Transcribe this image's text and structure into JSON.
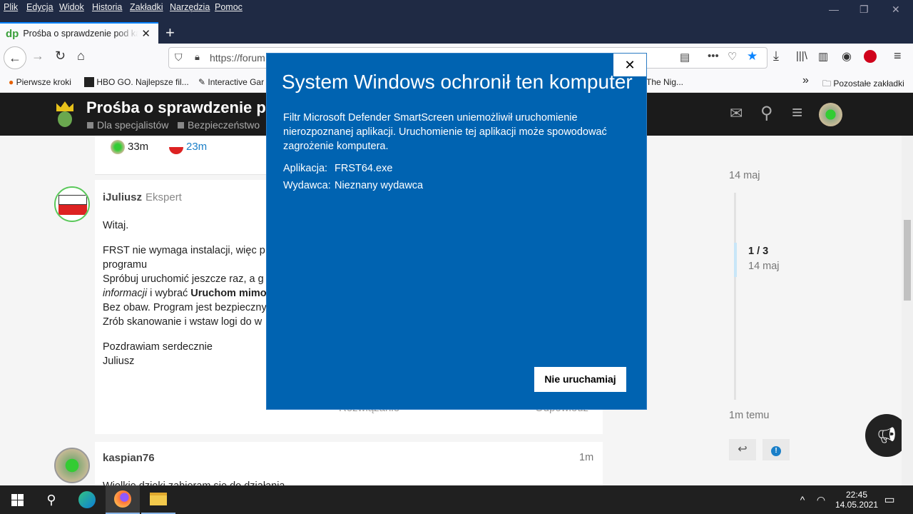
{
  "menubar": {
    "items": [
      "Plik",
      "Edycja",
      "Widok",
      "Historia",
      "Zakładki",
      "Narzędzia",
      "Pomoc"
    ]
  },
  "tab": {
    "favicon": "dp",
    "title": "Prośba o sprawdzenie pod kątem"
  },
  "urlbar": {
    "url": "https://forum"
  },
  "bookmarks": {
    "items": [
      "Pierwsze kroki",
      "HBO GO. Najlepsze fil...",
      "Interactive Gar",
      "The Nig..."
    ],
    "other": "Pozostałe zakładki"
  },
  "forum": {
    "title": "Prośba o sprawdzenie po",
    "categories": [
      "Dla specjalistów",
      "Bezpieczeństwo"
    ]
  },
  "summary": {
    "created": "33m",
    "last_reply": "23m"
  },
  "post1": {
    "user": "iJuliusz",
    "role": "Ekspert",
    "greeting": "Witaj.",
    "line1": "FRST nie wymaga instalacji, więc p",
    "line2": "programu",
    "line3": "Spróbuj uruchomić jeszcze raz, a g",
    "line4a": "informacji",
    "line4b": " i wybrać ",
    "line4c": "Uruchom mimo",
    "line5": "Bez obaw. Program jest bezpieczny",
    "line6": "Zrób skanowanie i wstaw logi do w",
    "regards": "Pozdrawiam serdecznie",
    "sign": "Juliusz",
    "actions": {
      "solution": "Rozwiązanie",
      "reply": "Odpowiedz"
    }
  },
  "post2": {
    "user": "kaspian76",
    "time": "1m",
    "text": "Wielkie dzięki zabieram się do działania"
  },
  "timeline": {
    "top_date": "14 maj",
    "position": "1 / 3",
    "pos_date": "14 maj",
    "bottom": "1m temu"
  },
  "dialog": {
    "title": "System Windows ochronił ten komputer",
    "message": "Filtr Microsoft Defender SmartScreen uniemożliwił uruchomienie nierozpoznanej aplikacji. Uruchomienie tej aplikacji może spowodować zagrożenie komputera.",
    "app_label": "Aplikacja:",
    "app_value": "FRST64.exe",
    "publisher_label": "Wydawca:",
    "publisher_value": "Nieznany wydawca",
    "button": "Nie uruchamiaj",
    "close": "✕"
  },
  "taskbar": {
    "time": "22:45",
    "date": "14.05.2021"
  },
  "colors": {
    "dialog_bg": "#0063b1",
    "forum_header": "#1b1b1b",
    "titlebar": "#1f2a44",
    "taskbar": "#202020"
  }
}
